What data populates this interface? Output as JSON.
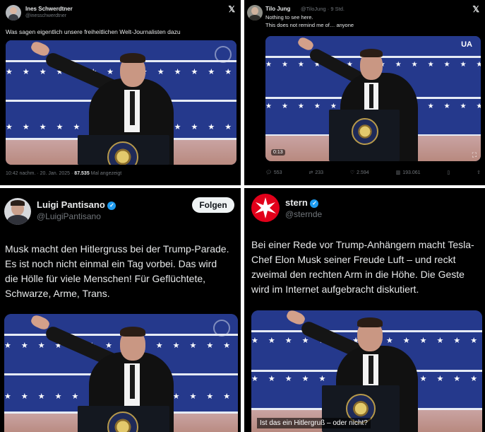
{
  "tweet1": {
    "author_name": "Ines Schwerdtner",
    "author_handle": "@inesschwerdtner",
    "text": "Was sagen eigentlich unsere freiheitlichen Welt-Journalisten dazu",
    "timestamp": "10:42 nachm. · 20. Jan. 2025 · ",
    "views_count": "87.535",
    "views_label": " Mal angezeigt"
  },
  "tweet2": {
    "author_name": "Tilo Jung",
    "author_handle": "@TiloJung · 9 Std.",
    "text_line1": "Nothing to see here.",
    "text_line2": "This does not remind me of… anyone",
    "media_watermark": "UA",
    "video_duration": "0:13",
    "replies": "553",
    "reposts": "233",
    "likes": "2.594",
    "views": "193.061"
  },
  "tweet3": {
    "author_name": "Luigi Pantisano",
    "author_handle": "@LuigiPantisano",
    "follow_label": "Folgen",
    "text": "Musk macht den Hitlergruss bei der Trump-Parade. Es ist noch nicht einmal ein Tag vorbei. Das wird die Hölle für viele Menschen! Für Geflüchtete, Schwarze, Arme, Trans."
  },
  "tweet4": {
    "author_name": "stern",
    "author_handle": "@sternde",
    "text": "Bei einer Rede vor Trump-Anhängern macht Tesla-Chef Elon Musk seiner Freude Luft – und reckt zweimal den rechten Arm in die Höhe. Die Geste wird im Internet aufgebracht diskutiert.",
    "video_caption": "Ist das ein Hitlergruß – oder nicht?"
  },
  "icons": {
    "x_logo": "x-logo-icon",
    "verified": "verified-badge-icon",
    "reply": "reply-icon",
    "repost": "repost-icon",
    "like": "like-icon",
    "views": "views-icon",
    "bookmark": "bookmark-icon"
  },
  "colors": {
    "background": "#000000",
    "text": "#e7e9ea",
    "secondary": "#71767b",
    "verified": "#1d9bf0",
    "stern_red": "#e2001a"
  }
}
